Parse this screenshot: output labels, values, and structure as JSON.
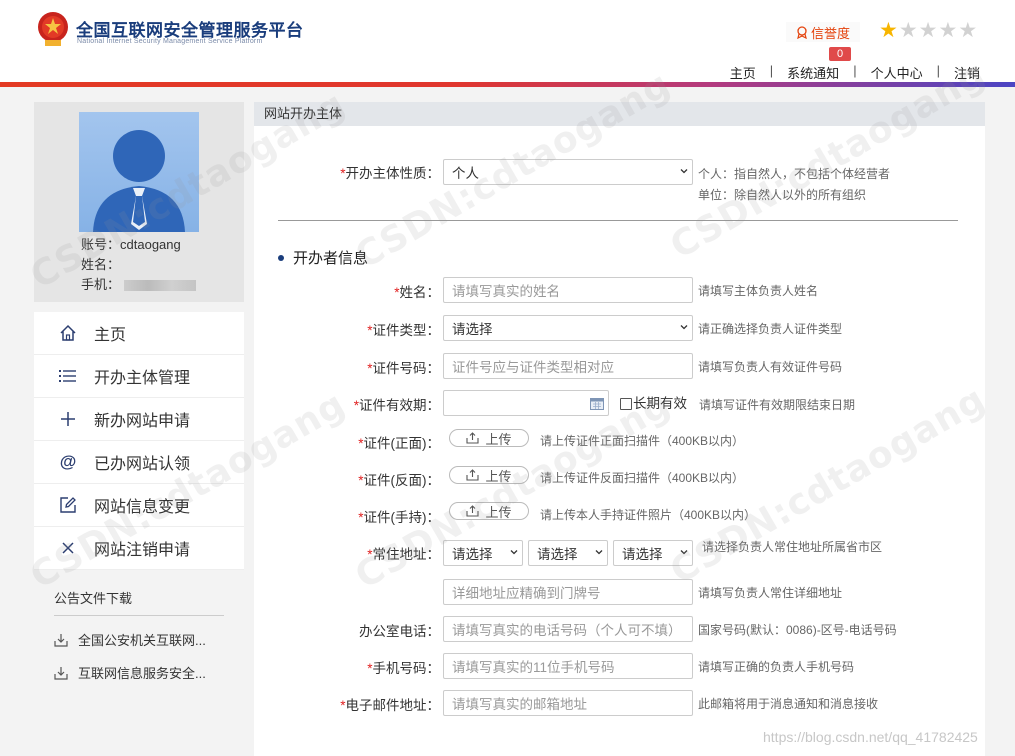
{
  "header": {
    "title": "全国互联网安全管理服务平台",
    "subtitle": "National Internet Security Management Service Platform",
    "credit_label": "信誉度",
    "rating": 1,
    "rating_max": 5,
    "notification_count": "0",
    "nav": [
      "主页",
      "系统通知",
      "个人中心",
      "注销"
    ]
  },
  "profile": {
    "account_label": "账号：",
    "account": "cdtaogang",
    "name_label": "姓名：",
    "name": "",
    "phone_label": "手机："
  },
  "menu": [
    {
      "label": "主页",
      "icon": "home-icon"
    },
    {
      "label": "开办主体管理",
      "icon": "list-icon"
    },
    {
      "label": "新办网站申请",
      "icon": "plus-icon"
    },
    {
      "label": "已办网站认领",
      "icon": "at-icon"
    },
    {
      "label": "网站信息变更",
      "icon": "edit-icon"
    },
    {
      "label": "网站注销申请",
      "icon": "close-icon"
    }
  ],
  "downloads": {
    "title": "公告文件下载",
    "items": [
      "全国公安机关互联网...",
      "互联网信息服务安全..."
    ]
  },
  "panel": {
    "title": "网站开办主体"
  },
  "form": {
    "subject_type": {
      "label": "开办主体性质：",
      "value": "个人",
      "hint1": "个人：指自然人，不包括个体经营者",
      "hint2": "单位：除自然人以外的所有组织"
    },
    "section_title": "开办者信息",
    "name": {
      "label": "姓名：",
      "placeholder": "请填写真实的姓名",
      "hint": "请填写主体负责人姓名"
    },
    "id_type": {
      "label": "证件类型：",
      "value": "请选择",
      "hint": "请正确选择负责人证件类型"
    },
    "id_number": {
      "label": "证件号码：",
      "placeholder": "证件号应与证件类型相对应",
      "hint": "请填写负责人有效证件号码"
    },
    "id_validity": {
      "label": "证件有效期：",
      "long_term": "长期有效",
      "hint": "请填写证件有效期限结束日期"
    },
    "id_front": {
      "label": "证件(正面)：",
      "button": "上传",
      "hint": "请上传证件正面扫描件（400KB以内）"
    },
    "id_back": {
      "label": "证件(反面)：",
      "button": "上传",
      "hint": "请上传证件反面扫描件（400KB以内）"
    },
    "id_hold": {
      "label": "证件(手持)：",
      "button": "上传",
      "hint": "请上传本人手持证件照片（400KB以内）"
    },
    "address": {
      "label": "常住地址：",
      "selects": [
        "请选择",
        "请选择",
        "请选择"
      ],
      "hint": "请选择负责人常住地址所属省市区",
      "detail_placeholder": "详细地址应精确到门牌号",
      "detail_hint": "请填写负责人常住详细地址"
    },
    "office_phone": {
      "label": "办公室电话：",
      "placeholder": "请填写真实的电话号码（个人可不填）",
      "hint": "国家号码(默认：0086)-区号-电话号码"
    },
    "mobile": {
      "label": "手机号码：",
      "placeholder": "请填写真实的11位手机号码",
      "hint": "请填写正确的负责人手机号码"
    },
    "email": {
      "label": "电子邮件地址：",
      "placeholder": "请填写真实的邮箱地址",
      "hint": "此邮箱将用于消息通知和消息接收"
    }
  },
  "watermark": "CSDN:cdtaogang",
  "footer_watermark": "https://blog.csdn.net/qq_41782425",
  "colors": {
    "accent_red": "#e33a23",
    "accent_blue": "#4b45c4",
    "title_blue": "#1a3d7c",
    "star": "#f7b500"
  }
}
